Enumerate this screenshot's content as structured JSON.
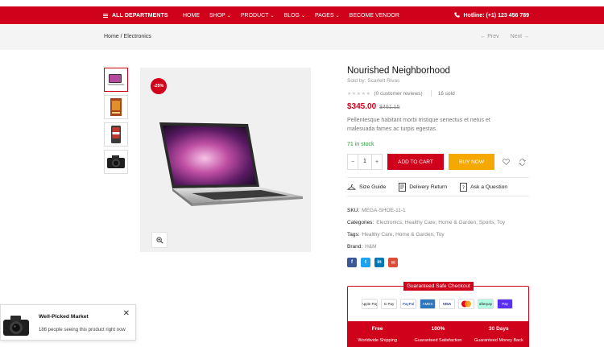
{
  "nav": {
    "departments": "ALL DEPARTMENTS",
    "items": [
      {
        "label": "HOME",
        "dropdown": false
      },
      {
        "label": "SHOP",
        "dropdown": true
      },
      {
        "label": "PRODUCT",
        "dropdown": true
      },
      {
        "label": "BLOG",
        "dropdown": true
      },
      {
        "label": "PAGES",
        "dropdown": true
      },
      {
        "label": "BECOME VENDOR",
        "dropdown": false
      }
    ],
    "hotline": "Hotline: (+1) 123 456 789"
  },
  "breadcrumb": {
    "home": "Home",
    "separator": "/",
    "current": "Electronics",
    "prev": "← Prev",
    "next": "Next →"
  },
  "product": {
    "sale_badge": "-25%",
    "title": "Nourished Neighborhood",
    "sold_by": "Sold by: Scarlett Rivas",
    "stars": "★★★★★",
    "reviews": "(0 customer reviews)",
    "sold": "16 sold",
    "price": "$345.00",
    "old_price": "$461.15",
    "description": "Pellentesque habitant morbi tristique senectus et netus et malesuada fames ac turpis egestas.",
    "stock": "71 in stock",
    "quantity": "1",
    "qty_minus": "−",
    "qty_plus": "+",
    "add_to_cart": "ADD TO CART",
    "buy_now": "BUY NOW",
    "size_guide": "Size Guide",
    "delivery_return": "Delivery Return",
    "ask_question": "Ask a Question",
    "sku_label": "SKU:",
    "sku": "MEGA-SHOE-11-1",
    "categories_label": "Categories:",
    "categories": "Electronics, Healthy Care, Home & Garden, Sports, Toy",
    "tags_label": "Tags:",
    "tags": "Healthy Care, Home & Garden, Toy",
    "brand_label": "Brand:",
    "brand": "H&M"
  },
  "social": [
    {
      "name": "facebook",
      "glyph": "f",
      "color": "#3b5998"
    },
    {
      "name": "twitter",
      "glyph": "t",
      "color": "#1da1f2"
    },
    {
      "name": "linkedin",
      "glyph": "in",
      "color": "#0077b5"
    },
    {
      "name": "email",
      "glyph": "✉",
      "color": "#dd4b39"
    }
  ],
  "checkout": {
    "title": "Guaranteed Safe Checkout",
    "payments": [
      "Apple Pay",
      "G Pay",
      "PayPal",
      "AMEX",
      "VISA",
      "MC",
      "afterpay",
      "Pay"
    ],
    "perks": [
      {
        "title": "Free",
        "sub": "Worldwide Shipping"
      },
      {
        "title": "100%",
        "sub": "Guaranteed Satisfaction"
      },
      {
        "title": "30 Days",
        "sub": "Guaranteed Money Back"
      }
    ]
  },
  "toast": {
    "title": "Well-Picked Market",
    "message": "186 people seeing this product right now",
    "close": "✕"
  },
  "colors": {
    "brand_red": "#d0021b",
    "buy_now": "#f5a800",
    "in_stock": "#2a9d3a"
  }
}
